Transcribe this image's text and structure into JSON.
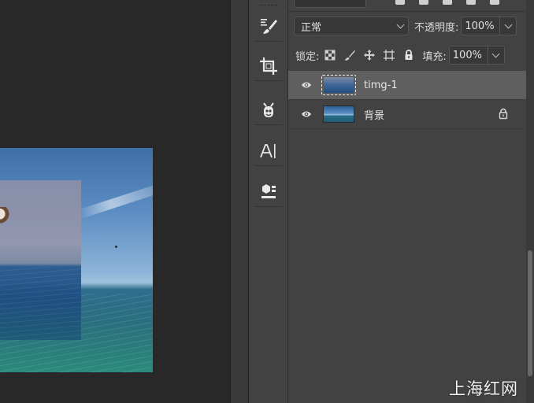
{
  "layers_panel": {
    "blend_mode": "正常",
    "opacity_label": "不透明度:",
    "opacity_value": "100%",
    "lock_label": "锁定:",
    "fill_label": "填充:",
    "fill_value": "100%",
    "layers": [
      {
        "name": "timg-1",
        "visible": true,
        "selected": true,
        "locked": false
      },
      {
        "name": "背景",
        "visible": true,
        "selected": false,
        "locked": true
      }
    ]
  },
  "toolbar": {
    "tools": [
      "brush-tool",
      "crop-tool",
      "character-tool",
      "type-tool",
      "3d-material-tool"
    ]
  },
  "watermark": "上海红网",
  "colors": {
    "panel_bg": "#424242",
    "canvas_bg": "#282828",
    "selected_row": "#5f5f5f"
  }
}
